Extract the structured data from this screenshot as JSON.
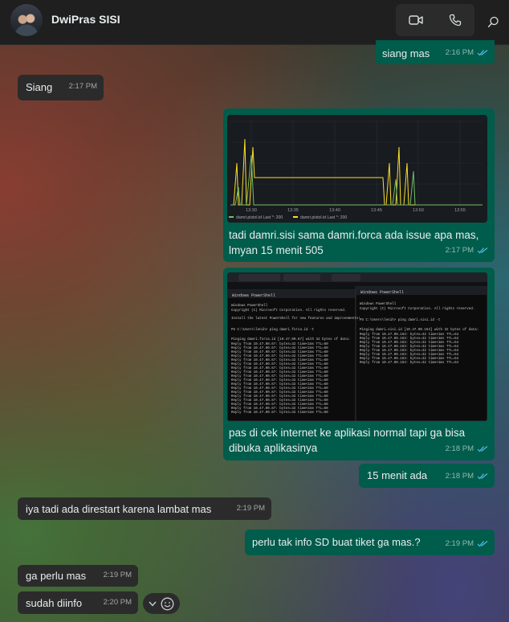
{
  "header": {
    "contact_name": "DwiPras SISI",
    "icons": [
      "video-call-icon",
      "voice-call-icon",
      "search-icon"
    ]
  },
  "messages": [
    {
      "direction": "out",
      "text": "siang mas",
      "time": "2:16 PM",
      "status": "read"
    },
    {
      "direction": "in",
      "text": "Siang",
      "time": "2:17 PM"
    },
    {
      "direction": "out",
      "type": "image+text",
      "text": "tadi damri.sisi sama damri.forca ada issue apa mas, lmyan 15 menit 505",
      "time": "2:17 PM",
      "status": "read"
    },
    {
      "direction": "out",
      "type": "image+text",
      "text": "pas di cek internet ke aplikasi normal tapi ga bisa dibuka aplikasinya",
      "time": "2:18 PM",
      "status": "read"
    },
    {
      "direction": "out",
      "text": "15 menit ada",
      "time": "2:18 PM",
      "status": "read"
    },
    {
      "direction": "in",
      "text": "iya tadi ada direstart karena lambat mas",
      "time": "2:19 PM"
    },
    {
      "direction": "out",
      "text": "perlu tak info SD buat tiket ga mas.?",
      "time": "2:19 PM",
      "status": "read"
    },
    {
      "direction": "in",
      "text": "ga perlu mas",
      "time": "2:19 PM"
    },
    {
      "direction": "in",
      "text": "sudah diinfo",
      "time": "2:20 PM"
    }
  ],
  "chart_data": {
    "type": "line",
    "x": [
      "13:30",
      "13:35",
      "13:40",
      "13:45",
      "13:50",
      "13:55"
    ],
    "series": [
      {
        "name": "damri.pistol.id",
        "color": "#73bf69",
        "legend_value": "Last *: 200"
      },
      {
        "name": "damri.pistol.id",
        "color": "#fade2a",
        "legend_value": "Last *: 200"
      }
    ],
    "legend_texts": [
      "damri.pistol.id  Last *: 200",
      "damri.pistol.id  Last *: 200"
    ]
  },
  "screenshot_windows": {
    "tab_left": "Windows PowerShell",
    "tab_right": "Windows PowerShell",
    "left_header": "Windows PowerShell",
    "left_copyright": "Copyright (C) Microsoft Corporation. All rights reserved.",
    "left_install": "Install the latest PowerShell for new features and improvements!",
    "left_prompt": "PS C:\\Users\\lenih> ping damri.forca.id -t",
    "left_pinging": "Pinging damri.forca.id [10.47.00.67] with 32 bytes of data:",
    "left_reply": "Reply from 10.47.00.67: bytes=32 time<1ms TTL=60",
    "right_header": "Windows PowerShell",
    "right_copyright": "Copyright (C) Microsoft Corporation. All rights reserved.",
    "right_prompt": "PS C:\\Users\\lenih> ping damri.sisi.id -t",
    "right_pinging": "Pinging damri.sisi.id [10.47.00.163] with 32 bytes of data:",
    "right_reply": "Reply from 10.47.00.163: bytes=32 time<1ms TTL=64"
  }
}
